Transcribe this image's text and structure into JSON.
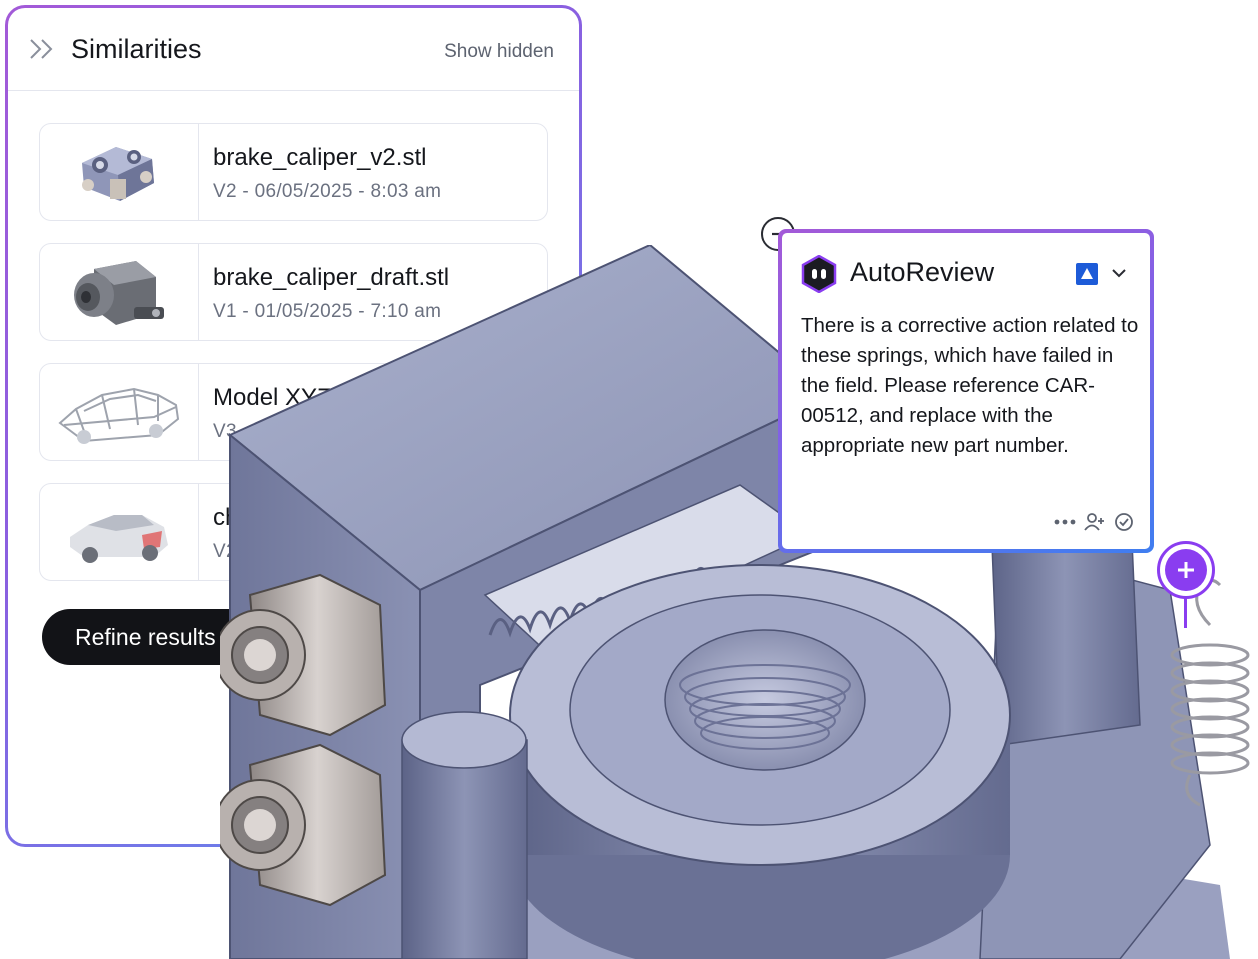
{
  "similarities": {
    "title": "Similarities",
    "show_hidden_label": "Show hidden",
    "items": [
      {
        "name": "brake_caliper_v2.stl",
        "meta": "V2 - 06/05/2025 - 8:03 am"
      },
      {
        "name": "brake_caliper_draft.stl",
        "meta": "V1 - 01/05/2025 - 7:10 am"
      },
      {
        "name": "Model XYZ",
        "meta": "V3"
      },
      {
        "name": "chassis",
        "meta": "V2 - 24"
      }
    ],
    "refine_label": "Refine results"
  },
  "autoreview": {
    "title": "AutoReview",
    "message": "There is a corrective action related to these springs, which have failed in the field. Please reference CAR-00512, and replace with the appropriate new part number.",
    "accent_color": "#8a3df0",
    "flag_color": "#1d5bd8"
  }
}
